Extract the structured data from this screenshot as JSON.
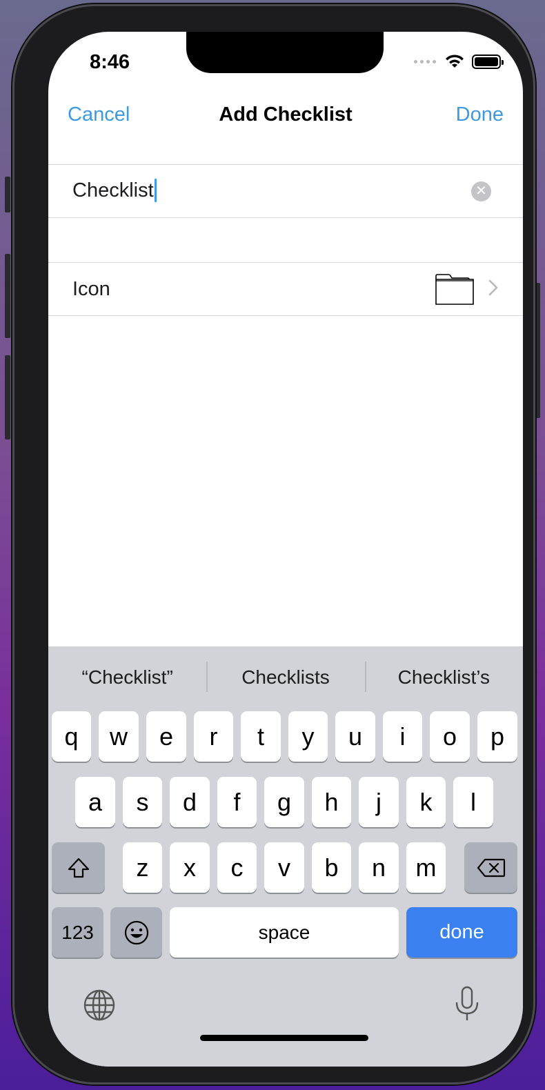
{
  "status": {
    "time": "8:46"
  },
  "nav": {
    "cancel": "Cancel",
    "title": "Add Checklist",
    "done": "Done"
  },
  "form": {
    "name_value": "Checklist",
    "clear_glyph": "✕",
    "icon_label": "Icon",
    "icon_name": "folder-icon"
  },
  "keyboard": {
    "suggestions": [
      "“Checklist”",
      "Checklists",
      "Checklist’s"
    ],
    "row1": [
      "q",
      "w",
      "e",
      "r",
      "t",
      "y",
      "u",
      "i",
      "o",
      "p"
    ],
    "row2": [
      "a",
      "s",
      "d",
      "f",
      "g",
      "h",
      "j",
      "k",
      "l"
    ],
    "row3": [
      "z",
      "x",
      "c",
      "v",
      "b",
      "n",
      "m"
    ],
    "numbers": "123",
    "space": "space",
    "done": "done"
  },
  "colors": {
    "accent": "#3a9be0",
    "done_key": "#3a80f0",
    "keyboard_bg": "#d1d3d9"
  }
}
